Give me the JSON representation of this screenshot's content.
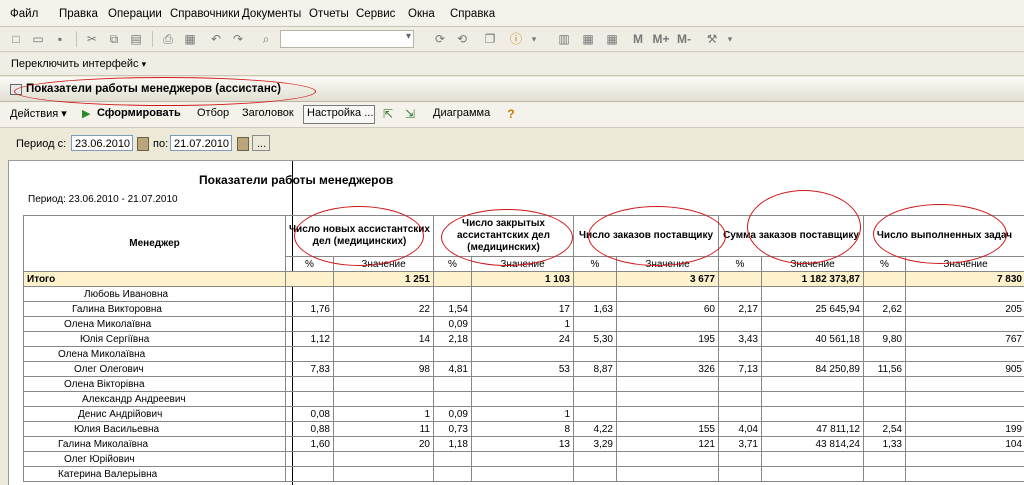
{
  "menu": [
    "Файл",
    "Правка",
    "Операции",
    "Справочники",
    "Документы",
    "Отчеты",
    "Сервис",
    "Окна",
    "Справка"
  ],
  "toolbar": {
    "m_buttons": [
      "M",
      "M+",
      "M-"
    ]
  },
  "switch_interface": "Переключить интерфейс",
  "window_title": "Показатели работы менеджеров (ассистанс)",
  "form_toolbar": {
    "actions": "Действия",
    "generate": "Сформировать",
    "filter": "Отбор",
    "header": "Заголовок",
    "settings": "Настройка ...",
    "diagram": "Диаграмма"
  },
  "period": {
    "from_label": "Период с:",
    "from": "23.06.2010",
    "to_label": "по:",
    "to": "21.07.2010",
    "more": "..."
  },
  "report": {
    "title": "Показатели работы менеджеров",
    "period": "Период: 23.06.2010 - 21.07.2010",
    "manager_header": "Менеджер",
    "groups": [
      "Число новых ассистантских дел (медицинских)",
      "Число закрытых ассистантских дел (медицинских)",
      "Число заказов поставщику",
      "Сумма заказов поставщику",
      "Число выполненных задач"
    ],
    "pct": "%",
    "value": "Значение",
    "total": {
      "name": "Итого",
      "cells": [
        "",
        "1 251",
        "",
        "1 103",
        "",
        "3 677",
        "",
        "1 182 373,87",
        "",
        "7 830"
      ]
    },
    "rows": [
      {
        "name": "Любовь Ивановна",
        "indent": 60,
        "cells": [
          "",
          "",
          "",
          "",
          "",
          "",
          "",
          "",
          "",
          ""
        ]
      },
      {
        "name": "Галина Викторовна",
        "indent": 48,
        "cells": [
          "1,76",
          "22",
          "1,54",
          "17",
          "1,63",
          "60",
          "2,17",
          "25 645,94",
          "2,62",
          "205"
        ]
      },
      {
        "name": "Олена Миколаївна",
        "indent": 40,
        "cells": [
          "",
          "",
          "0,09",
          "1",
          "",
          "",
          "",
          "",
          "",
          ""
        ]
      },
      {
        "name": "Юлія Сергіївна",
        "indent": 56,
        "cells": [
          "1,12",
          "14",
          "2,18",
          "24",
          "5,30",
          "195",
          "3,43",
          "40 561,18",
          "9,80",
          "767"
        ]
      },
      {
        "name": "Олена Миколаївна",
        "indent": 34,
        "cells": [
          "",
          "",
          "",
          "",
          "",
          "",
          "",
          "",
          "",
          ""
        ]
      },
      {
        "name": "Олег Олегович",
        "indent": 50,
        "cells": [
          "7,83",
          "98",
          "4,81",
          "53",
          "8,87",
          "326",
          "7,13",
          "84 250,89",
          "11,56",
          "905"
        ]
      },
      {
        "name": "Олена Вікторівна",
        "indent": 40,
        "cells": [
          "",
          "",
          "",
          "",
          "",
          "",
          "",
          "",
          "",
          ""
        ]
      },
      {
        "name": "Александр Андреевич",
        "indent": 58,
        "cells": [
          "",
          "",
          "",
          "",
          "",
          "",
          "",
          "",
          "",
          ""
        ]
      },
      {
        "name": "Денис Андрійович",
        "indent": 54,
        "cells": [
          "0,08",
          "1",
          "0,09",
          "1",
          "",
          "",
          "",
          "",
          "",
          ""
        ]
      },
      {
        "name": "Юлия Васильевна",
        "indent": 50,
        "cells": [
          "0,88",
          "11",
          "0,73",
          "8",
          "4,22",
          "155",
          "4,04",
          "47 811,12",
          "2,54",
          "199"
        ]
      },
      {
        "name": "Галина Миколаївна",
        "indent": 34,
        "cells": [
          "1,60",
          "20",
          "1,18",
          "13",
          "3,29",
          "121",
          "3,71",
          "43 814,24",
          "1,33",
          "104"
        ]
      },
      {
        "name": "Олег Юрійович",
        "indent": 40,
        "cells": [
          "",
          "",
          "",
          "",
          "",
          "",
          "",
          "",
          "",
          ""
        ]
      },
      {
        "name": "Катерина Валерьівна",
        "indent": 34,
        "cells": [
          "",
          "",
          "",
          "",
          "",
          "",
          "",
          "",
          "",
          ""
        ]
      }
    ]
  }
}
